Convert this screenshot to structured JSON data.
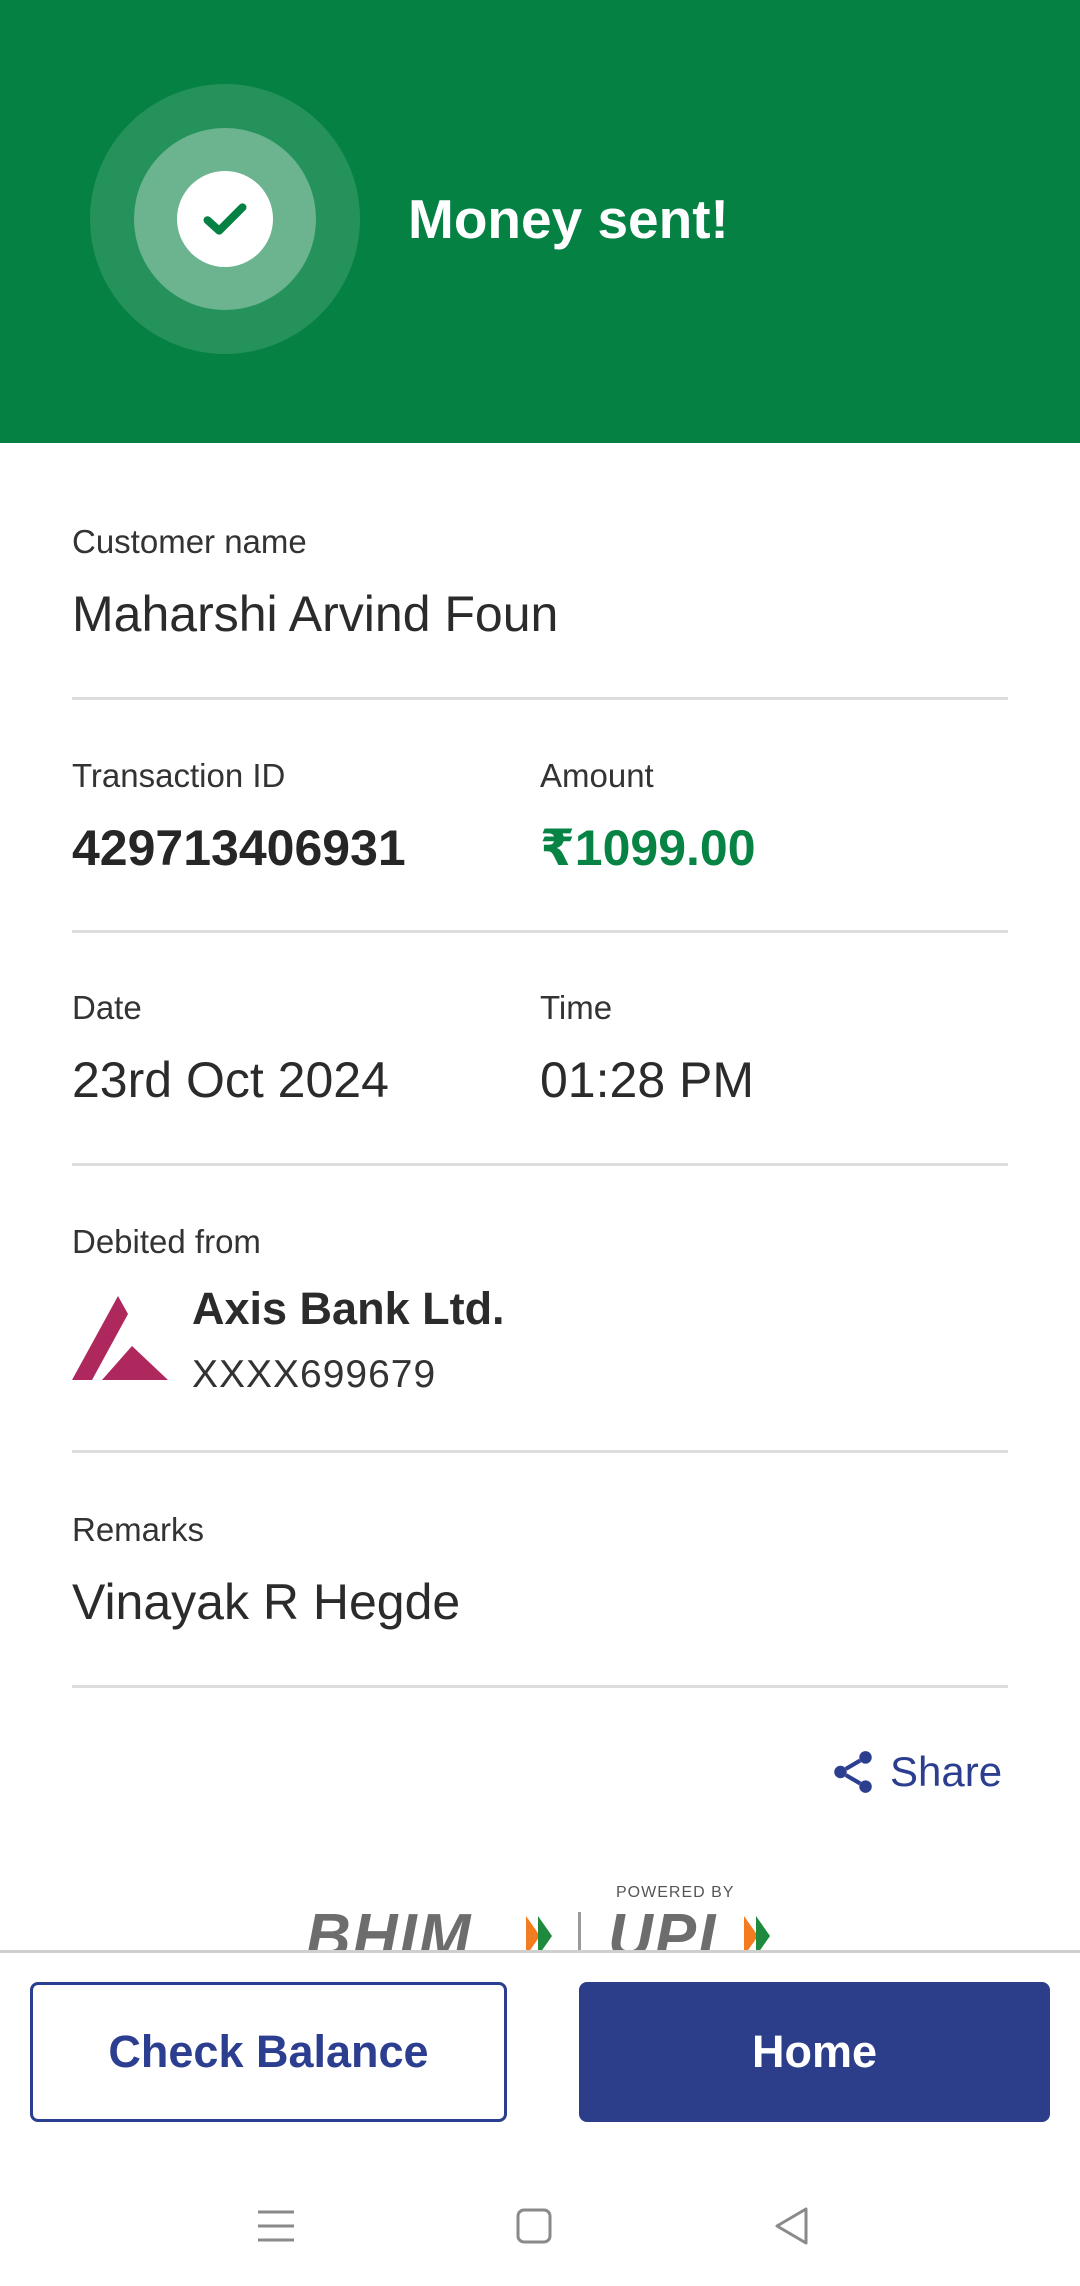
{
  "header": {
    "title": "Money sent!"
  },
  "customer": {
    "label": "Customer name",
    "value": "Maharshi Arvind Foun"
  },
  "transaction": {
    "label": "Transaction ID",
    "value": "429713406931"
  },
  "amount": {
    "label": "Amount",
    "value": "₹1099.00"
  },
  "date": {
    "label": "Date",
    "value": "23rd Oct 2024"
  },
  "time": {
    "label": "Time",
    "value": "01:28 PM"
  },
  "debited": {
    "label": "Debited from",
    "bank_name": "Axis Bank Ltd.",
    "account": "XXXX699679"
  },
  "remarks": {
    "label": "Remarks",
    "value": "Vinayak R Hegde"
  },
  "share": {
    "label": "Share"
  },
  "branding": {
    "powered_by": "POWERED BY",
    "bhim": "BHIM",
    "upi": "UPI"
  },
  "buttons": {
    "check_balance": "Check Balance",
    "home": "Home"
  },
  "colors": {
    "header_green": "#058143",
    "amount_green": "#078444",
    "primary_blue": "#2c3e8a",
    "axis_maroon": "#ae285d"
  },
  "system_nav": {
    "icons": [
      "menu-icon",
      "home-square-icon",
      "back-triangle-icon"
    ]
  }
}
